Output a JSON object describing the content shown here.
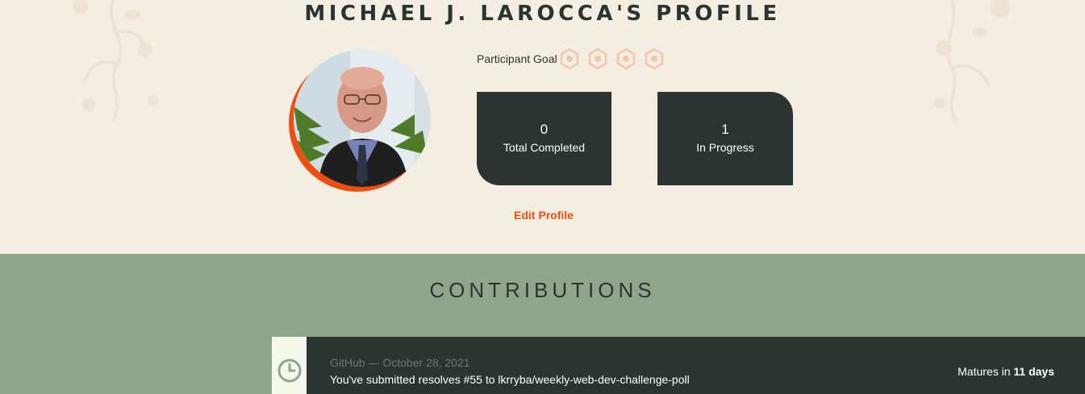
{
  "profile": {
    "title": "MICHAEL J. LAROCCA'S PROFILE",
    "avatar_alt": "Profile photo of Michael J. Larocca",
    "goal_label": "Participant Goal",
    "goal_icons": [
      "badge-icon",
      "badge-icon",
      "badge-icon",
      "badge-icon"
    ],
    "stats": [
      {
        "value": "0",
        "label": "Total Completed"
      },
      {
        "value": "1",
        "label": "In Progress"
      }
    ],
    "edit_label": "Edit Profile"
  },
  "contributions": {
    "title": "CONTRIBUTIONS",
    "items": [
      {
        "icon": "clock-icon",
        "source": "GitHub",
        "separator": "—",
        "date": "October 28, 2021",
        "text": "You've submitted resolves #55 to lkrryba/weekly-web-dev-challenge-poll",
        "matures_prefix": "Matures in",
        "matures_value": "11 days"
      }
    ]
  },
  "colors": {
    "page_bg": "#f3eee1",
    "dark": "#2b3431",
    "accent": "#ee4e10",
    "contrib_bg": "#90a68a",
    "goal_icon": "#f2c5ad"
  }
}
